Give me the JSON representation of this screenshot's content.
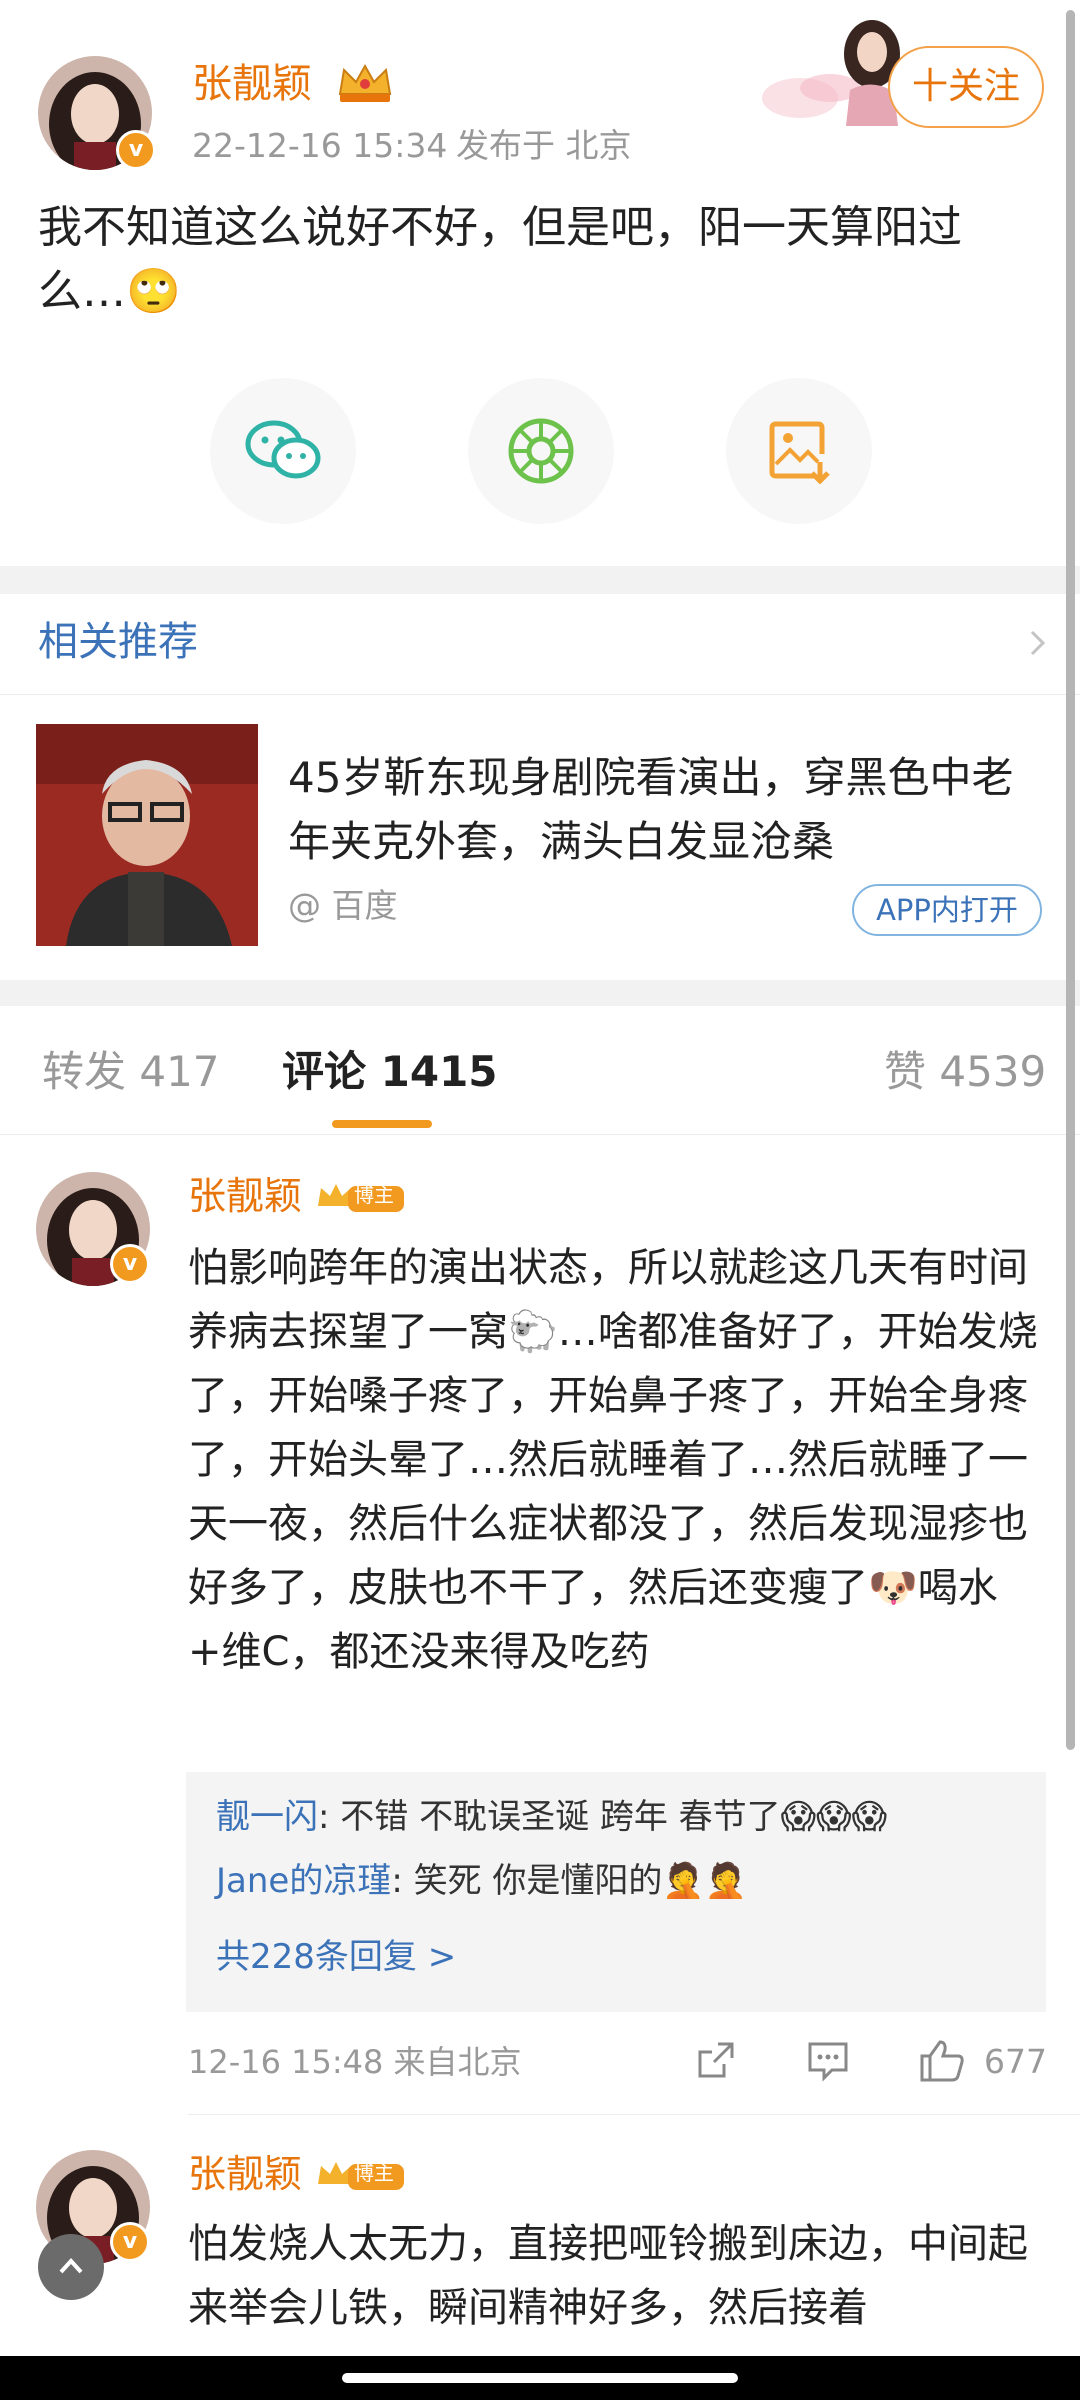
{
  "post": {
    "author": "张靓颖",
    "time": "22-12-16 15:34",
    "location": "发布于 北京",
    "text": "我不知道这么说好不好，但是吧，阳一天算阳过么…🙄",
    "follow_label": "十关注"
  },
  "share": {
    "icons": [
      "wechat-icon",
      "moments-icon",
      "save-image-icon"
    ]
  },
  "recommend": {
    "title": "相关推荐",
    "headline": "45岁靳东现身剧院看演出，穿黑色中老年夹克外套，满头白发显沧桑",
    "source": "@ 百度",
    "app_label": "APP内打开"
  },
  "tabs": {
    "repost": "转发 417",
    "comments": "评论 1415",
    "likes": "赞 4539"
  },
  "comments": [
    {
      "author": "张靓颖",
      "badge": "博主",
      "text": "怕影响跨年的演出状态，所以就趁这几天有时间养病去探望了一窝🐑…啥都准备好了，开始发烧了，开始嗓子疼了，开始鼻子疼了，开始全身疼了，开始头晕了…然后就睡着了…然后就睡了一天一夜，然后什么症状都没了，然后发现湿疹也好多了，皮肤也不干了，然后还变瘦了🐶喝水+维C，都还没来得及吃药",
      "replies": [
        {
          "user": "靓一闪",
          "text": ": 不错 不耽误圣诞 跨年 春节了😱😱😱"
        },
        {
          "user": "Jane的凉瑾",
          "text": ": 笑死 你是懂阳的🤦🤦"
        }
      ],
      "more_replies": "共228条回复 >",
      "time": "12-16 15:48 来自北京",
      "like_count": "677"
    },
    {
      "author": "张靓颖",
      "badge": "博主",
      "text": "怕发烧人太无力，直接把哑铃搬到床边，中间起来举会儿铁，瞬间精神好多，然后接着"
    }
  ],
  "colors": {
    "accent_orange": "#e8740c",
    "link_blue": "#3b72b8",
    "tab_underline": "#f29a1f"
  }
}
